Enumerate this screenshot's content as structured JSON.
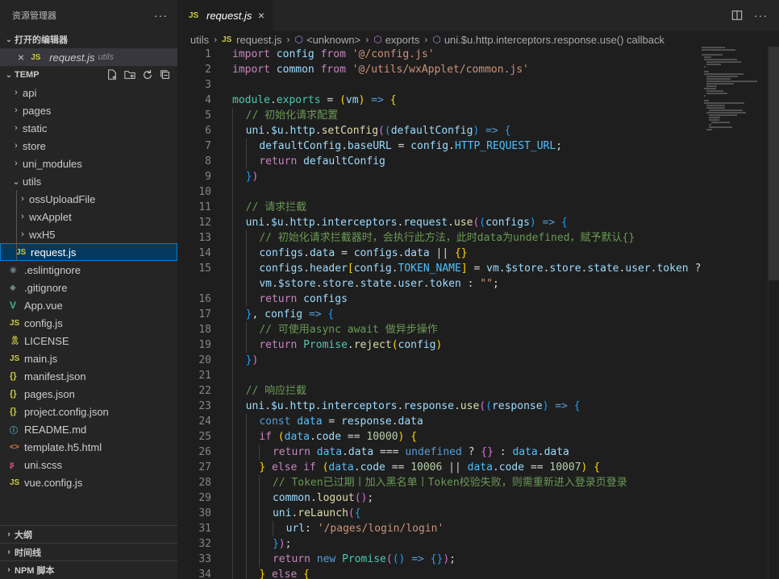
{
  "sidebar": {
    "title": "资源管理器",
    "more": "···",
    "open_editors": {
      "label": "打开的编辑器",
      "file": {
        "icon": "JS",
        "name": "request.js",
        "dir": "utils"
      }
    },
    "workspace": "TEMP",
    "tree": [
      {
        "name": "api",
        "type": "folder",
        "depth": 0
      },
      {
        "name": "pages",
        "type": "folder",
        "depth": 0
      },
      {
        "name": "static",
        "type": "folder",
        "depth": 0
      },
      {
        "name": "store",
        "type": "folder",
        "depth": 0
      },
      {
        "name": "uni_modules",
        "type": "folder",
        "depth": 0
      },
      {
        "name": "utils",
        "type": "folder-open",
        "depth": 0
      },
      {
        "name": "ossUploadFile",
        "type": "folder",
        "depth": 1
      },
      {
        "name": "wxApplet",
        "type": "folder",
        "depth": 1
      },
      {
        "name": "wxH5",
        "type": "folder",
        "depth": 1
      },
      {
        "name": "request.js",
        "type": "js",
        "depth": 1,
        "icon": "JS",
        "selected": true
      },
      {
        "name": ".eslintignore",
        "type": "eslint",
        "depth": 0,
        "icon": "◉"
      },
      {
        "name": ".gitignore",
        "type": "git",
        "depth": 0,
        "icon": "◆"
      },
      {
        "name": "App.vue",
        "type": "vue",
        "depth": 0,
        "icon": "V"
      },
      {
        "name": "config.js",
        "type": "js",
        "depth": 0,
        "icon": "JS"
      },
      {
        "name": "LICENSE",
        "type": "license",
        "depth": 0,
        "icon": "🎗"
      },
      {
        "name": "main.js",
        "type": "js",
        "depth": 0,
        "icon": "JS"
      },
      {
        "name": "manifest.json",
        "type": "json",
        "depth": 0,
        "icon": "{}"
      },
      {
        "name": "pages.json",
        "type": "json",
        "depth": 0,
        "icon": "{}"
      },
      {
        "name": "project.config.json",
        "type": "json",
        "depth": 0,
        "icon": "{}"
      },
      {
        "name": "README.md",
        "type": "md",
        "depth": 0,
        "icon": "ⓘ"
      },
      {
        "name": "template.h5.html",
        "type": "html",
        "depth": 0,
        "icon": "<>"
      },
      {
        "name": "uni.scss",
        "type": "scss",
        "depth": 0,
        "icon": "ʂ"
      },
      {
        "name": "vue.config.js",
        "type": "js",
        "depth": 0,
        "icon": "JS"
      }
    ],
    "bottom_sections": [
      "大纲",
      "时间线",
      "NPM 脚本"
    ]
  },
  "editor": {
    "tab": {
      "icon": "JS",
      "name": "request.js",
      "close": "×"
    },
    "breadcrumb": [
      "utils",
      "request.js",
      "<unknown>",
      "exports",
      "uni.$u.http.interceptors.response.use() callback"
    ],
    "lines": [
      {
        "n": "1",
        "d": 0,
        "h": "<span class='kc'>import</span> <span class='v'>config</span> <span class='kc'>from</span> <span class='s'>'@/config.js'</span>"
      },
      {
        "n": "2",
        "d": 0,
        "h": "<span class='kc'>import</span> <span class='v'>common</span> <span class='kc'>from</span> <span class='s'>'@/utils/wxApplet/common.js'</span>"
      },
      {
        "n": "3",
        "d": 0,
        "h": ""
      },
      {
        "n": "4",
        "d": 0,
        "h": "<span class='t'>module</span><span class='p'>.</span><span class='t'>exports</span> <span class='p'>=</span> <span class='b1'>(</span><span class='v'>vm</span><span class='b1'>)</span> <span class='k'>=&gt;</span> <span class='b1'>{</span>"
      },
      {
        "n": "5",
        "d": 1,
        "h": "<span class='c'>// 初始化请求配置</span>"
      },
      {
        "n": "6",
        "d": 1,
        "h": "<span class='v'>uni</span><span class='p'>.</span><span class='v'>$u</span><span class='p'>.</span><span class='v'>http</span><span class='p'>.</span><span class='f'>setConfig</span><span class='b2'>(</span><span class='b3'>(</span><span class='v'>defaultConfig</span><span class='b3'>)</span> <span class='k'>=&gt;</span> <span class='b3'>{</span>"
      },
      {
        "n": "7",
        "d": 2,
        "h": "<span class='v'>defaultConfig</span><span class='p'>.</span><span class='v'>baseURL</span> <span class='p'>=</span> <span class='v'>config</span><span class='p'>.</span><span class='cs'>HTTP_REQUEST_URL</span><span class='p'>;</span>"
      },
      {
        "n": "8",
        "d": 2,
        "h": "<span class='kc'>return</span> <span class='v'>defaultConfig</span>"
      },
      {
        "n": "9",
        "d": 1,
        "h": "<span class='b3'>}</span><span class='b2'>)</span>"
      },
      {
        "n": "10",
        "d": 1,
        "h": ""
      },
      {
        "n": "11",
        "d": 1,
        "h": "<span class='c'>// 请求拦截</span>"
      },
      {
        "n": "12",
        "d": 1,
        "h": "<span class='v'>uni</span><span class='p'>.</span><span class='v'>$u</span><span class='p'>.</span><span class='v'>http</span><span class='p'>.</span><span class='v'>interceptors</span><span class='p'>.</span><span class='v'>request</span><span class='p'>.</span><span class='f'>use</span><span class='b2'>(</span><span class='b3'>(</span><span class='v'>configs</span><span class='b3'>)</span> <span class='k'>=&gt;</span> <span class='b3'>{</span>"
      },
      {
        "n": "13",
        "d": 2,
        "h": "<span class='c'>// 初始化请求拦截器时，会执行此方法，此时data为undefined，赋予默认{}</span>"
      },
      {
        "n": "14",
        "d": 2,
        "h": "<span class='v'>configs</span><span class='p'>.</span><span class='v'>data</span> <span class='p'>=</span> <span class='v'>configs</span><span class='p'>.</span><span class='v'>data</span> <span class='p'>||</span> <span class='b1'>{}</span>"
      },
      {
        "n": "15",
        "d": 2,
        "h": "<span class='v'>configs</span><span class='p'>.</span><span class='v'>header</span><span class='b1'>[</span><span class='v'>config</span><span class='p'>.</span><span class='cs'>TOKEN_NAME</span><span class='b1'>]</span> <span class='p'>=</span> <span class='v'>vm</span><span class='p'>.</span><span class='v'>$store</span><span class='p'>.</span><span class='v'>store</span><span class='p'>.</span><span class='v'>state</span><span class='p'>.</span><span class='v'>user</span><span class='p'>.</span><span class='v'>token</span> <span class='p'>?</span>"
      },
      {
        "n": "",
        "d": 2,
        "h": "<span class='v'>vm</span><span class='p'>.</span><span class='v'>$store</span><span class='p'>.</span><span class='v'>store</span><span class='p'>.</span><span class='v'>state</span><span class='p'>.</span><span class='v'>user</span><span class='p'>.</span><span class='v'>token</span> <span class='p'>:</span> <span class='s'>\"\"</span><span class='p'>;</span>"
      },
      {
        "n": "16",
        "d": 2,
        "h": "<span class='kc'>return</span> <span class='v'>configs</span>"
      },
      {
        "n": "17",
        "d": 1,
        "h": "<span class='b3'>}</span><span class='p'>,</span> <span class='v'>config</span> <span class='k'>=&gt;</span> <span class='b3'>{</span>"
      },
      {
        "n": "18",
        "d": 2,
        "h": "<span class='c'>// 可使用async await 做异步操作</span>"
      },
      {
        "n": "19",
        "d": 2,
        "h": "<span class='kc'>return</span> <span class='t'>Promise</span><span class='p'>.</span><span class='f'>reject</span><span class='b1'>(</span><span class='v'>config</span><span class='b1'>)</span>"
      },
      {
        "n": "20",
        "d": 1,
        "h": "<span class='b3'>}</span><span class='b2'>)</span>"
      },
      {
        "n": "21",
        "d": 1,
        "h": ""
      },
      {
        "n": "22",
        "d": 1,
        "h": "<span class='c'>// 响应拦截</span>"
      },
      {
        "n": "23",
        "d": 1,
        "h": "<span class='v'>uni</span><span class='p'>.</span><span class='v'>$u</span><span class='p'>.</span><span class='v'>http</span><span class='p'>.</span><span class='v'>interceptors</span><span class='p'>.</span><span class='v'>response</span><span class='p'>.</span><span class='f'>use</span><span class='b2'>(</span><span class='b3'>(</span><span class='v'>response</span><span class='b3'>)</span> <span class='k'>=&gt;</span> <span class='b3'>{</span>"
      },
      {
        "n": "24",
        "d": 2,
        "h": "<span class='k'>const</span> <span class='cs'>data</span> <span class='p'>=</span> <span class='v'>response</span><span class='p'>.</span><span class='v'>data</span>"
      },
      {
        "n": "25",
        "d": 2,
        "h": "<span class='kc'>if</span> <span class='b1'>(</span><span class='cs'>data</span><span class='p'>.</span><span class='v'>code</span> <span class='p'>==</span> <span class='n'>10000</span><span class='b1'>)</span> <span class='b1'>{</span>"
      },
      {
        "n": "26",
        "d": 3,
        "h": "<span class='kc'>return</span> <span class='cs'>data</span><span class='p'>.</span><span class='v'>data</span> <span class='p'>===</span> <span class='k'>undefined</span> <span class='p'>?</span> <span class='b2'>{}</span> <span class='p'>:</span> <span class='cs'>data</span><span class='p'>.</span><span class='v'>data</span>"
      },
      {
        "n": "27",
        "d": 2,
        "h": "<span class='b1'>}</span> <span class='kc'>else</span> <span class='kc'>if</span> <span class='b1'>(</span><span class='cs'>data</span><span class='p'>.</span><span class='v'>code</span> <span class='p'>==</span> <span class='n'>10006</span> <span class='p'>||</span> <span class='cs'>data</span><span class='p'>.</span><span class='v'>code</span> <span class='p'>==</span> <span class='n'>10007</span><span class='b1'>)</span> <span class='b1'>{</span>"
      },
      {
        "n": "28",
        "d": 3,
        "h": "<span class='c'>// Token已过期丨加入黑名单丨Token校验失败，则需重新进入登录页登录</span>"
      },
      {
        "n": "29",
        "d": 3,
        "h": "<span class='v'>common</span><span class='p'>.</span><span class='f'>logout</span><span class='b2'>()</span><span class='p'>;</span>"
      },
      {
        "n": "30",
        "d": 3,
        "h": "<span class='v'>uni</span><span class='p'>.</span><span class='f'>reLaunch</span><span class='b2'>(</span><span class='b3'>{</span>"
      },
      {
        "n": "31",
        "d": 4,
        "h": "<span class='v'>url</span><span class='p'>:</span> <span class='s'>'/pages/login/login'</span>"
      },
      {
        "n": "32",
        "d": 3,
        "h": "<span class='b3'>}</span><span class='b2'>)</span><span class='p'>;</span>"
      },
      {
        "n": "33",
        "d": 3,
        "h": "<span class='kc'>return</span> <span class='k'>new</span> <span class='t'>Promise</span><span class='b2'>(</span><span class='b3'>()</span> <span class='k'>=&gt;</span> <span class='b3'>{}</span><span class='b2'>)</span><span class='p'>;</span>"
      },
      {
        "n": "34",
        "d": 2,
        "h": "<span class='b1'>}</span> <span class='kc'>else</span> <span class='b1'>{</span>"
      }
    ]
  }
}
